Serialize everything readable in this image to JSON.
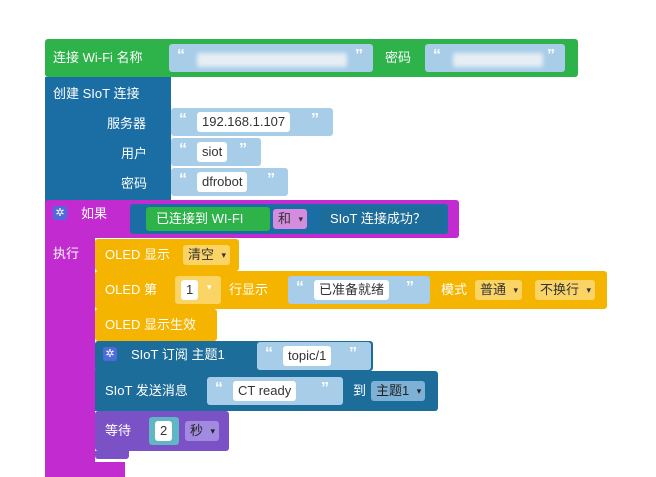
{
  "wifi": {
    "label": "连接 Wi-Fi 名称",
    "password_label": "密码"
  },
  "siot_connect": {
    "label": "创建 SIoT 连接",
    "server_label": "服务器",
    "server_value": "192.168.1.107",
    "user_label": "用户",
    "user_value": "siot",
    "password_label": "密码",
    "password_value": "dfrobot"
  },
  "if_block": {
    "if_label": "如果",
    "do_label": "执行",
    "cond_wifi": "已连接到 WI-FI",
    "and_label": "和",
    "cond_siot": "SIoT 连接成功？"
  },
  "oled_show": {
    "label": "OLED 显示",
    "option": "清空"
  },
  "oled_line": {
    "label_a": "OLED 第",
    "line_value": "1",
    "label_b": "行显示",
    "text": "已准备就绪",
    "mode_label": "模式",
    "mode_value": "普通",
    "wrap_value": "不换行"
  },
  "oled_apply": {
    "label": "OLED 显示生效"
  },
  "subscribe": {
    "label": "SIoT 订阅 主题1",
    "topic": "topic/1"
  },
  "publish": {
    "label": "SIoT 发送消息",
    "message": "CT ready",
    "to_label": "到",
    "topic_value": "主题1"
  },
  "wait": {
    "label": "等待",
    "value": "2",
    "unit": "秒"
  },
  "colors": {
    "green": "#2db34a",
    "blue": "#1a6ea3",
    "magenta": "#c22bcf",
    "oled": "#f5b400",
    "siot": "#1d6d9a",
    "wait": "#7b52c6",
    "text_blue": "#a8cde8"
  }
}
